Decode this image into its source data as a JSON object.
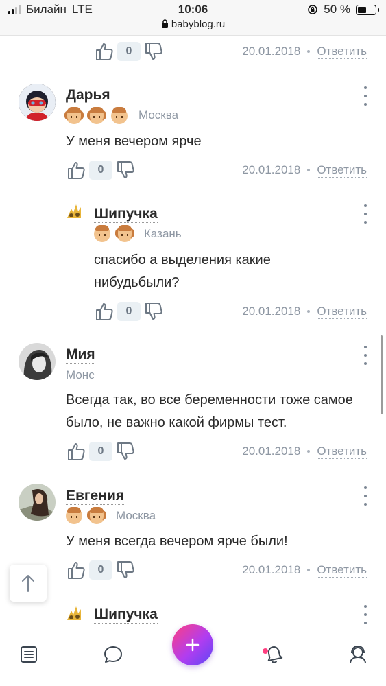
{
  "status_bar": {
    "carrier": "Билайн",
    "network": "LTE",
    "time": "10:06",
    "url": "babyblog.ru",
    "battery": "50 %",
    "battery_level": 0.5
  },
  "rating_default": "0",
  "reply_label": "Ответить",
  "comments": [
    {
      "author": "",
      "city": "",
      "text": "",
      "rating": "0",
      "date": "20.01.2018"
    },
    {
      "author": "Дарья",
      "city": "Москва",
      "text": "У меня вечером ярче",
      "rating": "0",
      "date": "20.01.2018"
    },
    {
      "author": "Шипучка",
      "city": "Казань",
      "text": "спасибо а выделения какие нибудьбыли?",
      "rating": "0",
      "date": "20.01.2018"
    },
    {
      "author": "Мия",
      "city": "Монс",
      "text": "Всегда так, во все беременности тоже самое было, не важно какой фирмы тест.",
      "rating": "0",
      "date": "20.01.2018"
    },
    {
      "author": "Евгения",
      "city": "Москва",
      "text": "У меня всегда вечером ярче были!",
      "rating": "0",
      "date": "20.01.2018"
    },
    {
      "author": "Шипучка",
      "city": "",
      "text": "",
      "rating": "",
      "date": ""
    }
  ],
  "tabs": [
    "feed-icon",
    "chat-icon",
    "add-icon",
    "bell-icon",
    "profile-icon"
  ],
  "colors": {
    "accent_gradient_start": "#ff3f80",
    "accent_gradient_end": "#5b47f5",
    "meta_gray": "#8e97a3",
    "rating_bg": "#eaf0f4"
  }
}
